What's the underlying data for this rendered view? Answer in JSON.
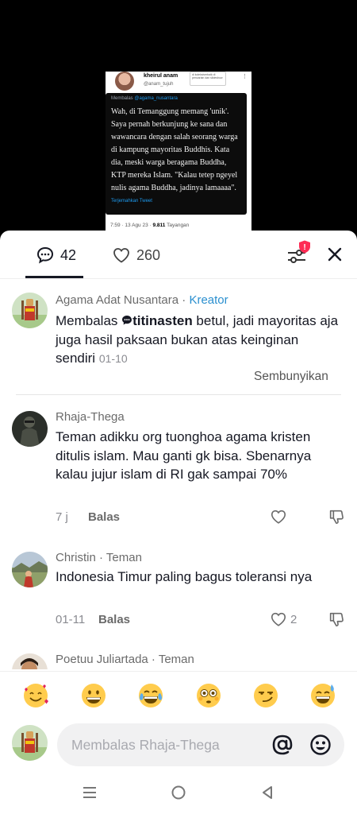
{
  "tweet": {
    "name": "kheirul anam",
    "handle": "@anam_tujuh",
    "popup_text": "di koleksiverbaik di pencarian dan slideshow",
    "reply_prefix": "Membalas",
    "reply_to": "@agama_nusantara",
    "text": "Wah, di Temanggung memang 'unik'. Saya pernah berkunjung ke sana dan wawancara dengan salah seorang warga di kampung mayoritas Buddhis. Kata dia, meski warga beragama Buddha, KTP mereka Islam. \"Kalau tetep ngeyel nulis agama Buddha, jadinya lamaaaa\".",
    "translate": "Terjemahkan Tweet",
    "meta_time": "7:59 · 13 Agu 23 · ",
    "meta_views": "9.811",
    "meta_views_label": " Tayangan"
  },
  "header": {
    "comments_count": "42",
    "likes_count": "260",
    "badge": "!"
  },
  "comments": [
    {
      "username": "Agama Adat Nusantara",
      "separator": " · ",
      "tag": "Kreator",
      "prefix": "Membalas ",
      "mention": "titinasten",
      "text": " betul, jadi mayoritas aja juga hasil paksaan bukan atas keinginan sendiri",
      "timestamp": "01-10",
      "hide_label": "Sembunyikan"
    },
    {
      "username": "Rhaja-Thega",
      "text": "Teman adikku org tuonghoa agama kristen ditulis islam. Mau ganti gk bisa. Sbenarnya kalau jujur islam di RI gak sampai 70%",
      "time": "7 j",
      "reply_label": "Balas",
      "likes": ""
    },
    {
      "username": "Christin",
      "separator": " · ",
      "tag": "Teman",
      "text": "Indonesia Timur paling bagus toleransi nya",
      "time": "01-11",
      "reply_label": "Balas",
      "likes": "2"
    },
    {
      "username": "Poetuu Juliartada",
      "separator": " · ",
      "tag": "Teman"
    }
  ],
  "emojis": [
    "smiling-face-with-hearts",
    "grinning-face",
    "face-with-tears-of-joy",
    "flushed-face",
    "smirking-face",
    "grinning-face-with-sweat"
  ],
  "reply_input": {
    "placeholder": "Membalas Rhaja-Thega"
  },
  "colors": {
    "creator_tag": "#2a8fcf",
    "badge": "#fe2c55",
    "text": "#161823",
    "muted": "#8a8b91"
  }
}
